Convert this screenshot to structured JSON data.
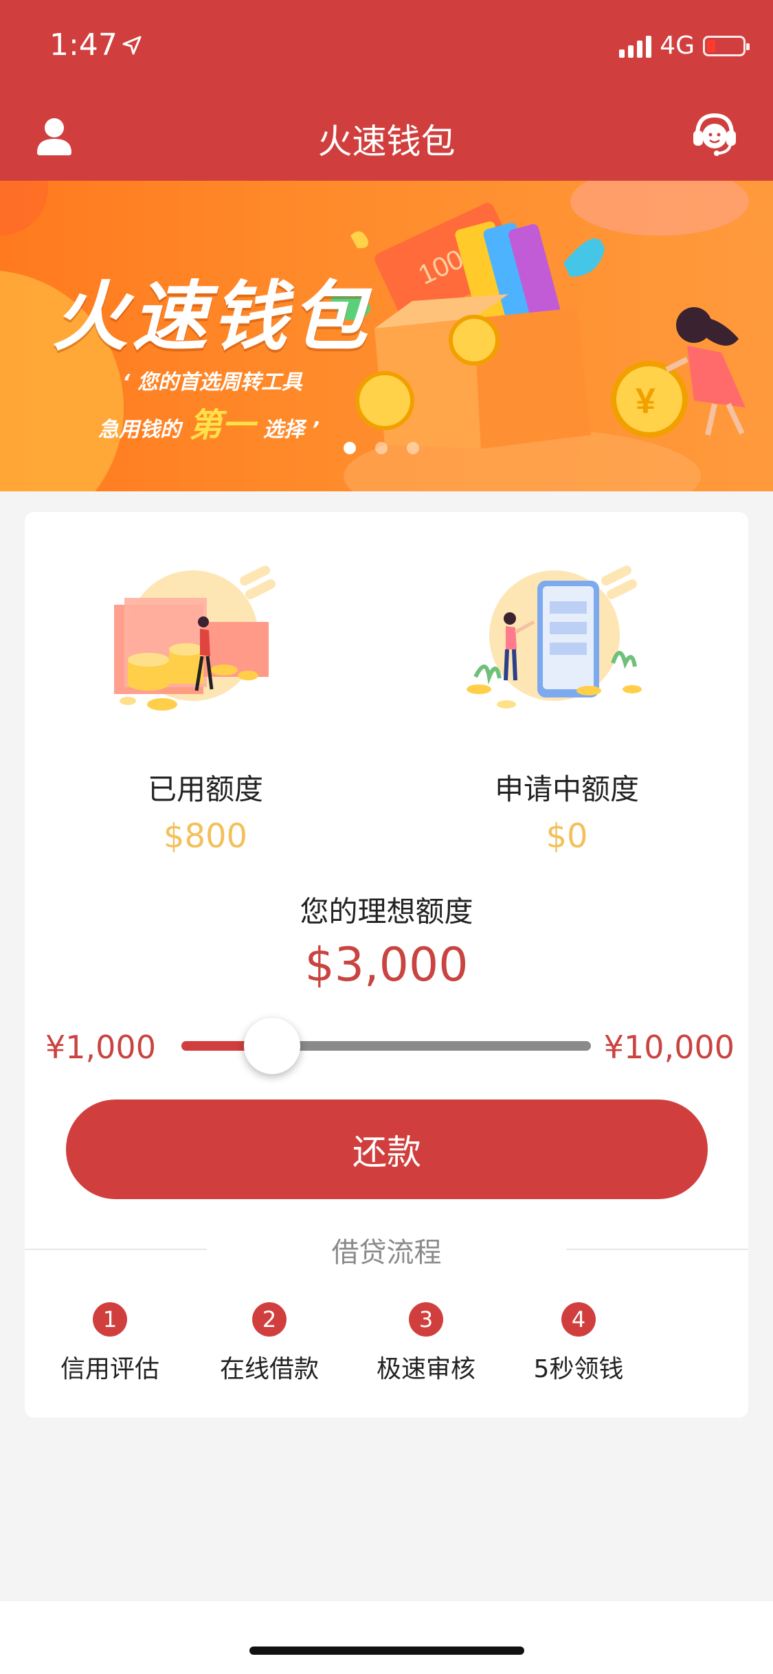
{
  "status_bar": {
    "time": "1:47",
    "network": "4G"
  },
  "header": {
    "title": "火速钱包"
  },
  "banner": {
    "title": "火速钱包",
    "line1": "‘ 您的首选周转工具",
    "line2_prefix": "急用钱的",
    "line2_highlight": "第一",
    "line2_suffix": "选择 ’",
    "note_text": "100",
    "coin_symbol": "¥",
    "slide_count": 3,
    "active_slide": 1
  },
  "quota": {
    "used": {
      "label": "已用额度",
      "value": "$800"
    },
    "applying": {
      "label": "申请中额度",
      "value": "$0"
    }
  },
  "ideal": {
    "label": "您的理想额度",
    "value": "$3,000"
  },
  "slider": {
    "min_label": "¥1,000",
    "max_label": "¥10,000",
    "min": 1000,
    "max": 10000,
    "value": 3000
  },
  "repay_button": {
    "label": "还款"
  },
  "process": {
    "title": "借贷流程",
    "steps": [
      {
        "num": "1",
        "label": "信用评估"
      },
      {
        "num": "2",
        "label": "在线借款"
      },
      {
        "num": "3",
        "label": "极速审核"
      },
      {
        "num": "4",
        "label": "5秒领钱"
      }
    ]
  },
  "colors": {
    "brand_red": "#d03f3d",
    "gold": "#f3c05a",
    "banner_orange": "#ff8a2a"
  }
}
